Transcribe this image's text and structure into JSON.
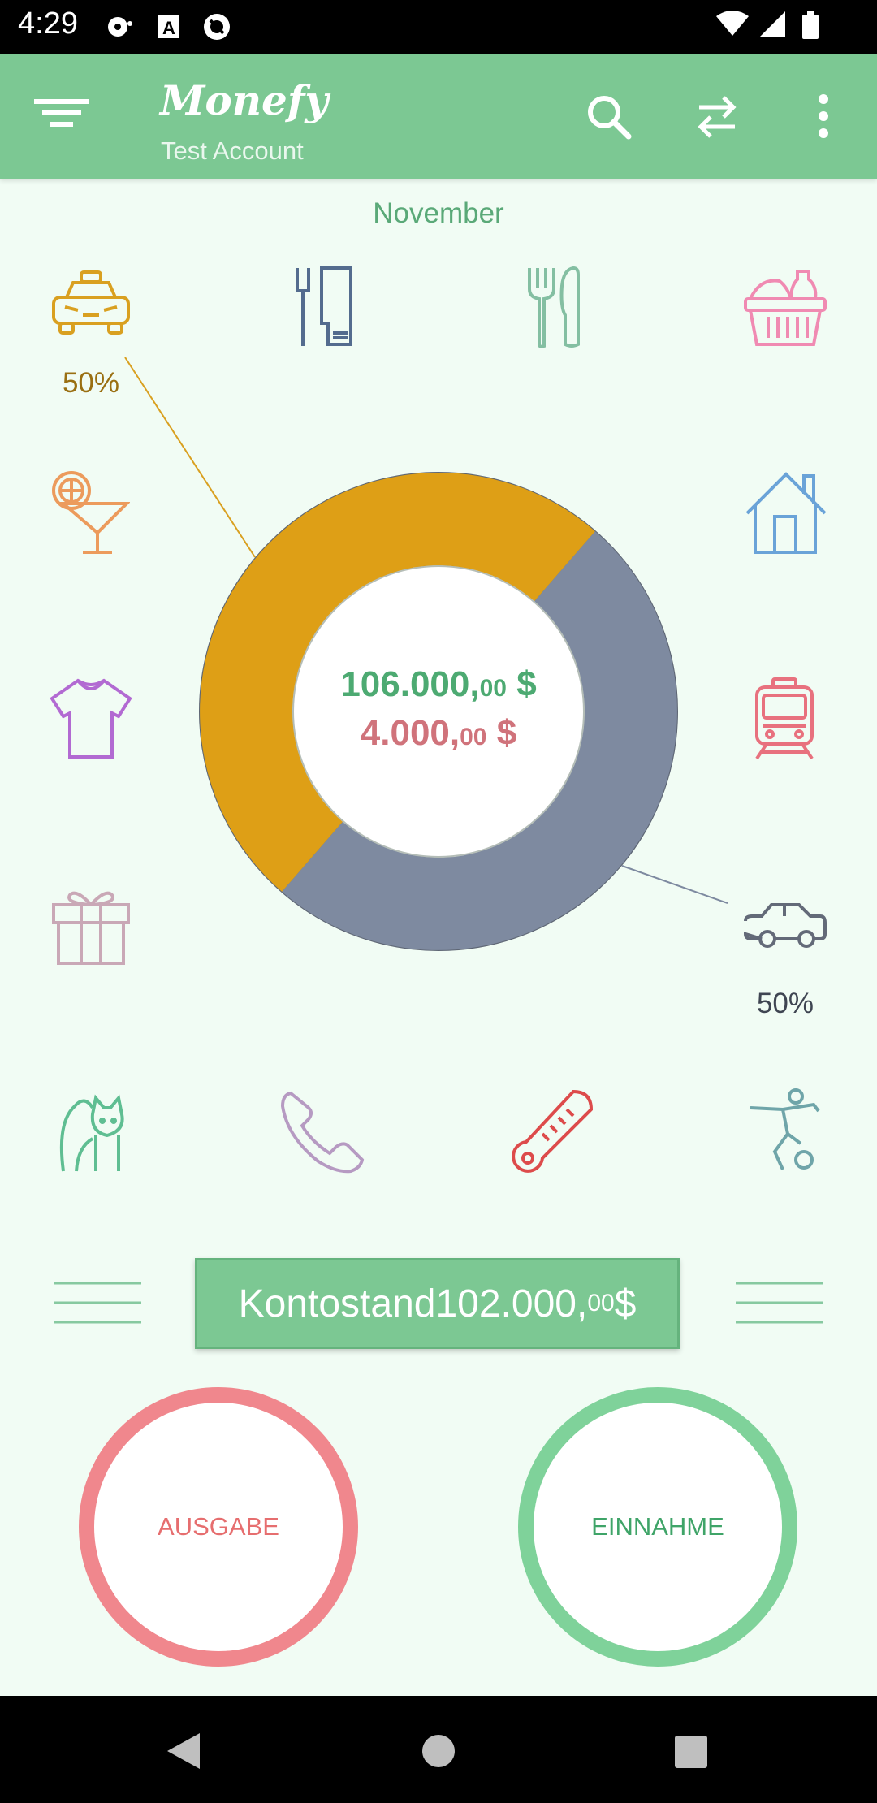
{
  "status_bar": {
    "time": "4:29"
  },
  "app_bar": {
    "title": "Monefy",
    "account": "Test Account"
  },
  "period": {
    "month": "November"
  },
  "chart_data": {
    "type": "pie",
    "categories": [
      "Taxi",
      "Car"
    ],
    "values": [
      50,
      50
    ],
    "colors": [
      "#de9f16",
      "#7e8aa0"
    ],
    "labels": [
      "50%",
      "50%"
    ]
  },
  "summary": {
    "income_main": "106.000,",
    "income_dec": "00",
    "income_cur": " $",
    "expense_main": "4.000,",
    "expense_dec": "00",
    "expense_cur": " $"
  },
  "categories": [
    {
      "name": "taxi",
      "icon": "taxi-icon",
      "color": "#d9a020",
      "percent": "50%"
    },
    {
      "name": "toiletries",
      "icon": "toiletries-icon",
      "color": "#546c8e"
    },
    {
      "name": "eating-out",
      "icon": "fork-knife-icon",
      "color": "#84bfa2"
    },
    {
      "name": "food",
      "icon": "basket-icon",
      "color": "#f08ab2"
    },
    {
      "name": "entertainment",
      "icon": "cocktail-icon",
      "color": "#ec9b5c"
    },
    {
      "name": "house",
      "icon": "house-icon",
      "color": "#6aa3d8"
    },
    {
      "name": "clothes",
      "icon": "tshirt-icon",
      "color": "#b26ad2"
    },
    {
      "name": "transport",
      "icon": "train-icon",
      "color": "#e8717e"
    },
    {
      "name": "gifts",
      "icon": "gift-icon",
      "color": "#c9a8b6"
    },
    {
      "name": "car",
      "icon": "car-icon",
      "color": "#636a78",
      "percent": "50%"
    },
    {
      "name": "pets",
      "icon": "cat-icon",
      "color": "#5fbe92"
    },
    {
      "name": "communications",
      "icon": "phone-icon",
      "color": "#b69ac2"
    },
    {
      "name": "health",
      "icon": "thermometer-icon",
      "color": "#dd4b4b"
    },
    {
      "name": "sports",
      "icon": "football-player-icon",
      "color": "#6fa5a9"
    }
  ],
  "balance": {
    "label": "Kontostand ",
    "main": "102.000,",
    "dec": "00",
    "cur": " $"
  },
  "buttons": {
    "expense": "AUSGABE",
    "income": "EINNAHME"
  }
}
